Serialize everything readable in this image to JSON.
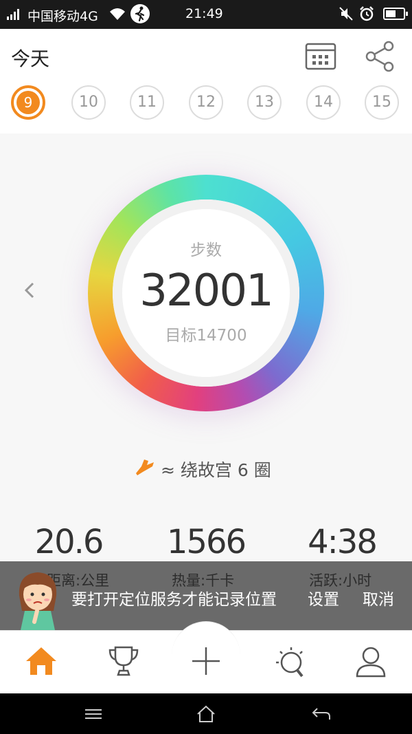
{
  "status_bar": {
    "carrier": "中国移动4G",
    "time": "21:49"
  },
  "header": {
    "title": "今天",
    "dates": [
      "9",
      "10",
      "11",
      "12",
      "13",
      "14",
      "15"
    ],
    "active_date": "9"
  },
  "ring": {
    "label": "步数",
    "value": "32001",
    "goal": "目标14700"
  },
  "fun_fact": "≈ 绕故宫 6 圈",
  "stats": [
    {
      "value": "20.6",
      "label": "距离:公里"
    },
    {
      "value": "1566",
      "label": "热量:千卡"
    },
    {
      "value": "4:38",
      "label": "活跃:小时"
    }
  ],
  "toast": {
    "message": "要打开定位服务才能记录位置",
    "settings_label": "设置",
    "cancel_label": "取消"
  },
  "nav": {
    "items": [
      "home-icon",
      "trophy-icon",
      "plus-icon",
      "lightbulb-icon",
      "profile-icon"
    ],
    "active": "home"
  },
  "colors": {
    "accent": "#f28a1f",
    "toast_bg": "#5f5f5f"
  }
}
